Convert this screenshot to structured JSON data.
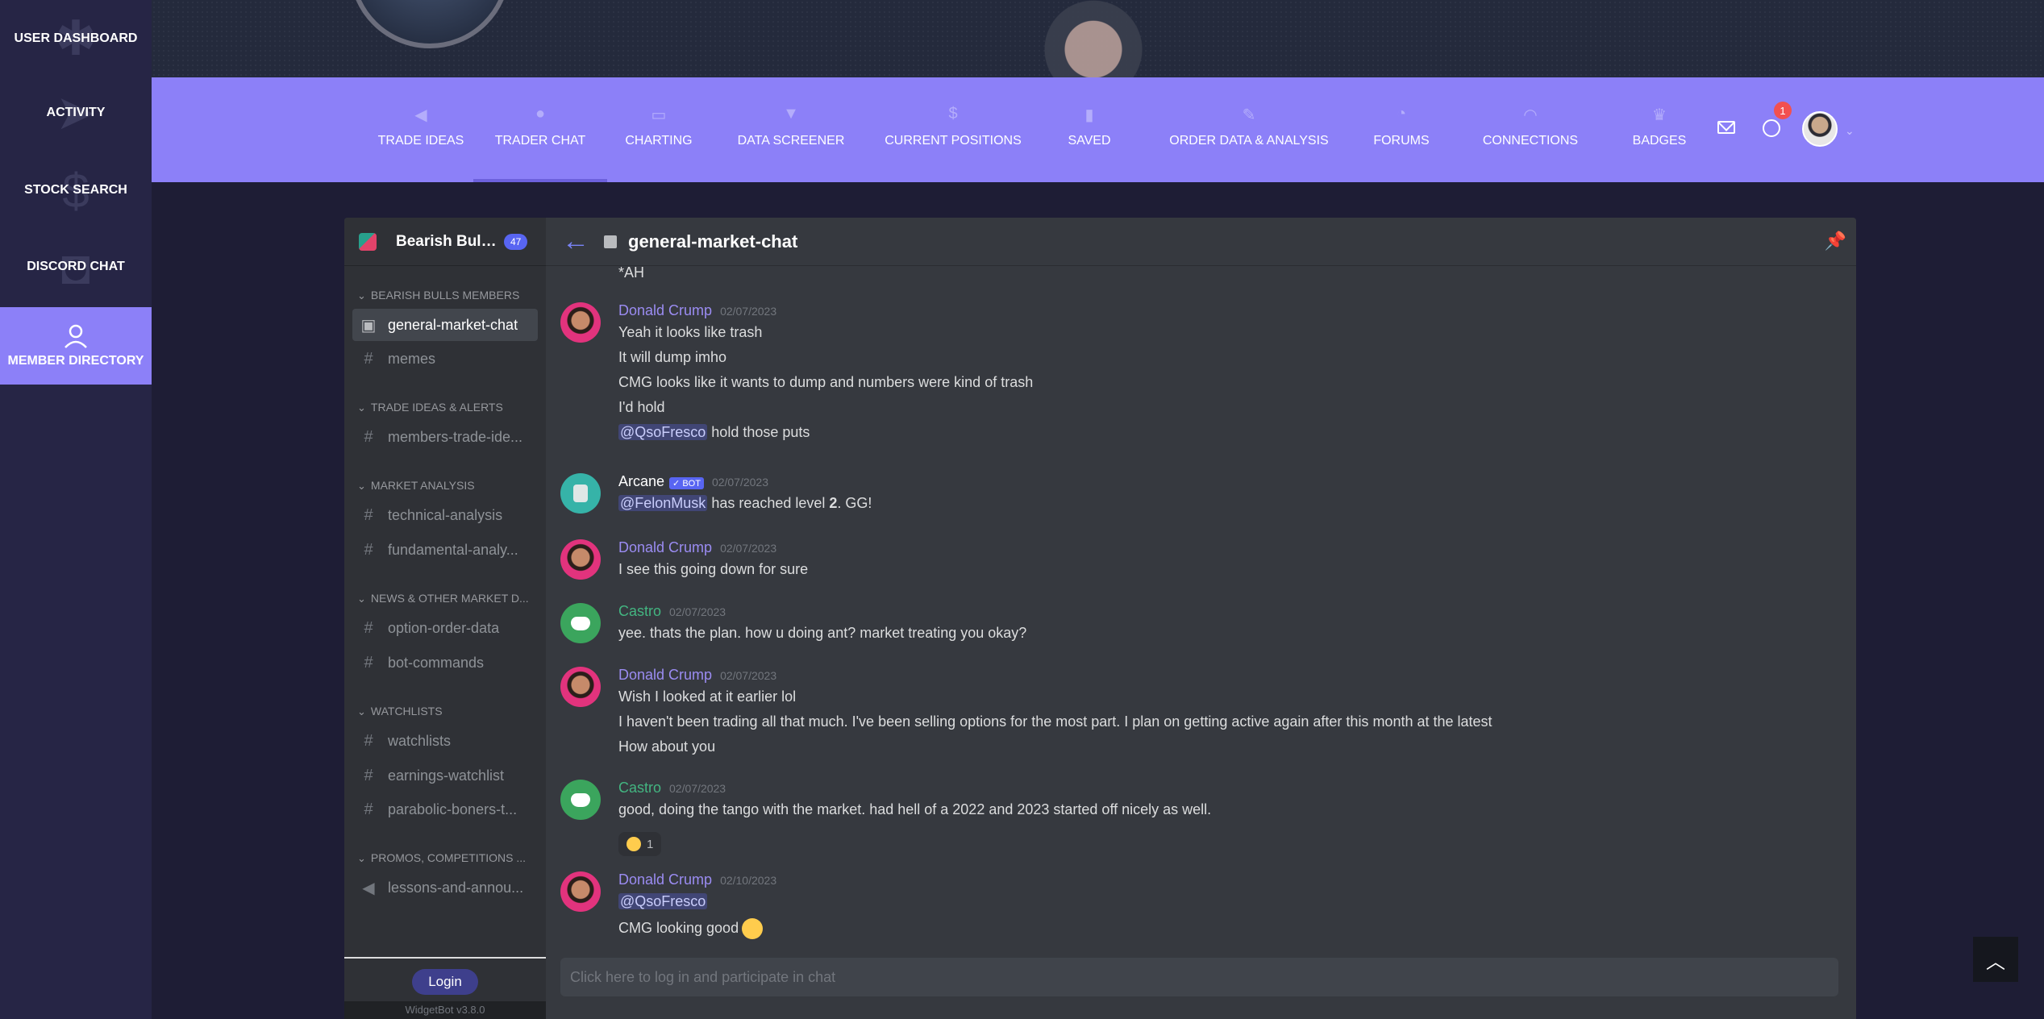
{
  "sidebar": {
    "items": [
      {
        "label": "USER DASHBOARD",
        "icon": "dashboard-icon",
        "active": false
      },
      {
        "label": "ACTIVITY",
        "icon": "paper-plane-icon",
        "active": false
      },
      {
        "label": "STOCK SEARCH",
        "icon": "dollar-icon",
        "active": false
      },
      {
        "label": "DISCORD CHAT",
        "icon": "chat-icon",
        "active": false
      },
      {
        "label": "MEMBER DIRECTORY",
        "icon": "user-icon",
        "active": true
      }
    ]
  },
  "topnav": {
    "items": [
      {
        "label": "TRADE IDEAS",
        "icon": "megaphone-icon"
      },
      {
        "label": "TRADER CHAT",
        "icon": "comments-icon",
        "active": true
      },
      {
        "label": "CHARTING",
        "icon": "monitor-icon"
      },
      {
        "label": "DATA SCREENER",
        "icon": "filter-icon"
      },
      {
        "label": "CURRENT POSITIONS",
        "icon": "dollar-icon"
      },
      {
        "label": "SAVED",
        "icon": "bookmark-icon"
      },
      {
        "label": "ORDER DATA & ANALYSIS",
        "icon": "pencil-icon"
      },
      {
        "label": "FORUMS",
        "icon": "forum-icon"
      },
      {
        "label": "CONNECTIONS",
        "icon": "rss-icon"
      },
      {
        "label": "BADGES",
        "icon": "trophy-icon"
      }
    ],
    "notification_count": "1",
    "accent": "#8c80f8"
  },
  "widget": {
    "server_name": "Bearish Bull...",
    "member_count": "47",
    "channel_title": "general-market-chat",
    "categories": [
      {
        "label": "BEARISH BULLS MEMBERS",
        "channels": [
          "general-market-chat",
          "memes"
        ]
      },
      {
        "label": "TRADE IDEAS & ALERTS",
        "channels": [
          "members-trade-ide..."
        ]
      },
      {
        "label": "MARKET ANALYSIS",
        "channels": [
          "technical-analysis",
          "fundamental-analy..."
        ]
      },
      {
        "label": "NEWS & OTHER MARKET D...",
        "channels": [
          "option-order-data",
          "bot-commands"
        ]
      },
      {
        "label": "WATCHLISTS",
        "channels": [
          "watchlists",
          "earnings-watchlist",
          "parabolic-boners-t..."
        ]
      },
      {
        "label": "PROMOS, COMPETITIONS ...",
        "channels": [
          "lessons-and-annou..."
        ]
      }
    ],
    "login_label": "Login",
    "version": "WidgetBot v3.8.0",
    "input_placeholder": "Click here to log in and participate in chat",
    "partial_top_line": "*AH"
  },
  "messages": [
    {
      "author": "Donald Crump",
      "time": "02/07/2023",
      "color": "purple",
      "avatar": "human",
      "lines": [
        "Yeah it looks like trash",
        "It will dump imho",
        "CMG looks like it wants to dump and numbers were kind of trash",
        "I'd hold"
      ],
      "mention_line": {
        "mention": "@QsoFresco",
        "text": " hold those puts"
      }
    },
    {
      "author": "Arcane",
      "bot_tag": "✓ BOT",
      "time": "02/07/2023",
      "color": "white",
      "avatar": "bot",
      "mention_line": {
        "mention": "@FelonMusk",
        "text_pre": " has reached level ",
        "level": "2",
        "text_post": ". GG!"
      }
    },
    {
      "author": "Donald Crump",
      "time": "02/07/2023",
      "color": "purple",
      "avatar": "human",
      "lines": [
        "I see this going down for sure"
      ]
    },
    {
      "author": "Castro",
      "time": "02/07/2023",
      "color": "green",
      "avatar": "discord",
      "lines": [
        "yee. thats the plan. how u doing ant? market treating you okay?"
      ]
    },
    {
      "author": "Donald Crump",
      "time": "02/07/2023",
      "color": "purple",
      "avatar": "human",
      "lines": [
        "Wish I looked at it earlier lol",
        "I haven't been trading all that much. I've been selling options for the most part. I plan on getting active again after this month at the latest",
        "How about you"
      ]
    },
    {
      "author": "Castro",
      "time": "02/07/2023",
      "color": "green",
      "avatar": "discord",
      "lines": [
        "good, doing the tango with the market. had hell of a 2022 and 2023 started off nicely as well."
      ],
      "reaction_count": "1"
    },
    {
      "author": "Donald Crump",
      "time": "02/10/2023",
      "color": "purple",
      "avatar": "human",
      "mention_only": "@QsoFresco",
      "lines": [
        "CMG looking good"
      ]
    }
  ]
}
